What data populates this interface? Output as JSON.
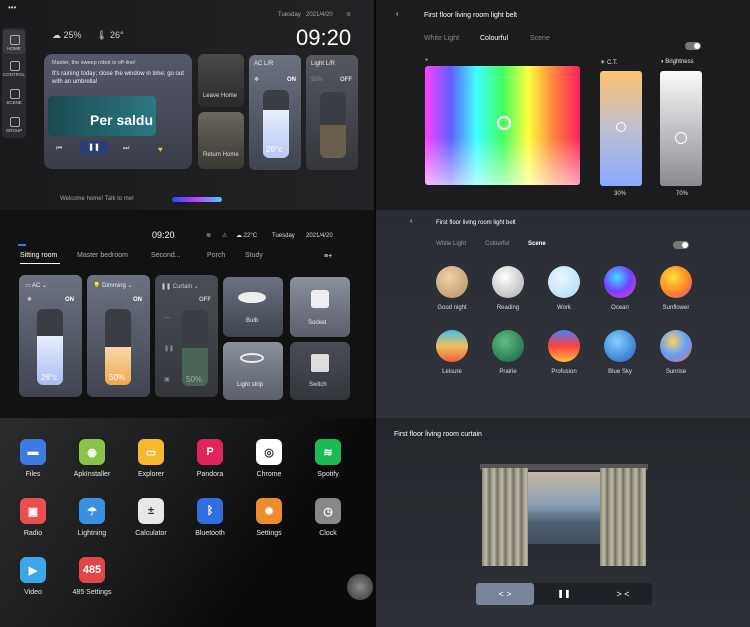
{
  "home": {
    "menu_dots": "•••",
    "nav": [
      "HOME",
      "CONTROL",
      "SCENE",
      "GROUP"
    ],
    "date": "Tuesday",
    "date2": "2021/4/20",
    "time": "09:20",
    "humidity": "25%",
    "temperature": "26°",
    "msg1": "Master, the sweep robot is off-line!",
    "msg2": "It's raining today; close the window in time; go out with an umbrella!",
    "music_title": "Per saldu",
    "leave_home": "Leave Home",
    "return_home": "Return Home",
    "ac_label": "AC L/R",
    "ac_on": "ON",
    "ac_temp": "26°c",
    "light_label": "Light L/R",
    "light_pct": "50%",
    "light_off": "OFF",
    "welcome": "Welcome home! Talk to me!"
  },
  "control": {
    "time": "09:20",
    "weather": "22°C",
    "date": "Tuesday",
    "date2": "2021/4/20",
    "tabs": [
      "Sitting room",
      "Master bedroom",
      "Second...",
      "Porch",
      "Study"
    ],
    "menu_icon": "≡+",
    "ac_label": "AC",
    "ac_on": "ON",
    "ac_temp": "26°c",
    "dim_label": "Dimming",
    "dim_on": "ON",
    "dim_val": "50%",
    "curtain_label": "Curtain",
    "curtain_off": "OFF",
    "curtain_val": "50%",
    "bulb": "Bulb",
    "socket": "Socket",
    "strip": "Light strip",
    "switch": "Switch"
  },
  "apps": [
    {
      "name": "Files",
      "color": "#3d7be0",
      "glyph": "▬"
    },
    {
      "name": "ApkInstaller",
      "color": "#8bc34a",
      "glyph": "◉"
    },
    {
      "name": "Explorer",
      "color": "#f5b82e",
      "glyph": "▭"
    },
    {
      "name": "Pandora",
      "color": "#e0245e",
      "glyph": "P"
    },
    {
      "name": "Chrome",
      "color": "#ffffff",
      "glyph": "◎"
    },
    {
      "name": "Spotify",
      "color": "#1db954",
      "glyph": "≋"
    },
    {
      "name": "Radio",
      "color": "#e94f4f",
      "glyph": "▣"
    },
    {
      "name": "Lightning",
      "color": "#3a8fe0",
      "glyph": "☂"
    },
    {
      "name": "Calculator",
      "color": "#e8e8e8",
      "glyph": "±"
    },
    {
      "name": "Bluetooth",
      "color": "#2f6fe0",
      "glyph": "ᛒ"
    },
    {
      "name": "Settings",
      "color": "#f08a2c",
      "glyph": "✹"
    },
    {
      "name": "Clock",
      "color": "#888888",
      "glyph": "◷"
    },
    {
      "name": "Video",
      "color": "#3aa8e8",
      "glyph": "▶"
    },
    {
      "name": "485 Settings",
      "color": "#e04848",
      "glyph": "485"
    }
  ],
  "light": {
    "title": "First floor living room light belt",
    "tabs": [
      "White Light",
      "Colourful",
      "Scene"
    ],
    "ct": "C.T.",
    "brightness": "Brightness",
    "ct_val": "30%",
    "br_val": "70%"
  },
  "scene": {
    "title": "First floor living room light belt",
    "tabs": [
      "White Light",
      "Colourful",
      "Scene"
    ],
    "items": [
      "Good night",
      "Reading",
      "Work",
      "Ocean",
      "Sunflower",
      "Leisure",
      "Prairie",
      "Profusion",
      "Blue Sky",
      "Sunrise"
    ]
  },
  "curtain": {
    "title": "First floor living room curtain",
    "open": "< >",
    "pause": "❚❚",
    "close": "> <"
  }
}
